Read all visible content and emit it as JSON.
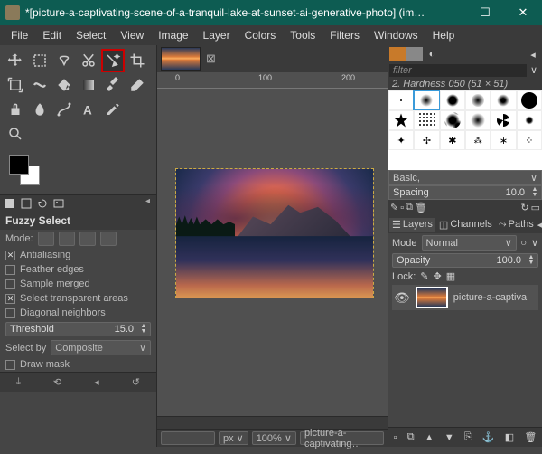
{
  "title": "*[picture-a-captivating-scene-of-a-tranquil-lake-at-sunset-ai-generative-photo] (imported)-3.0 (RG…",
  "menu": [
    "File",
    "Edit",
    "Select",
    "View",
    "Image",
    "Layer",
    "Colors",
    "Tools",
    "Filters",
    "Windows",
    "Help"
  ],
  "toolopts": {
    "header": "Fuzzy Select",
    "mode_label": "Mode:",
    "antialias": "Antialiasing",
    "feather": "Feather edges",
    "sample_merged": "Sample merged",
    "transparent": "Select transparent areas",
    "diag": "Diagonal neighbors",
    "threshold_label": "Threshold",
    "threshold_val": "15.0",
    "selectby_label": "Select by",
    "selectby_val": "Composite",
    "drawmask": "Draw mask"
  },
  "ruler": {
    "a": "0",
    "b": "100",
    "c": "200"
  },
  "status": {
    "zoom": "100",
    "unit": "px",
    "file": "picture-a-captivating…"
  },
  "brush": {
    "filter_ph": "filter",
    "label": "2. Hardness 050 (51 × 51)",
    "preset": "Basic,",
    "spacing_label": "Spacing",
    "spacing_val": "10.0"
  },
  "layers": {
    "tab_layers": "Layers",
    "tab_channels": "Channels",
    "tab_paths": "Paths",
    "mode_label": "Mode",
    "mode_val": "Normal",
    "opacity_label": "Opacity",
    "opacity_val": "100.0",
    "lock_label": "Lock:",
    "item": "picture-a-captiva"
  }
}
